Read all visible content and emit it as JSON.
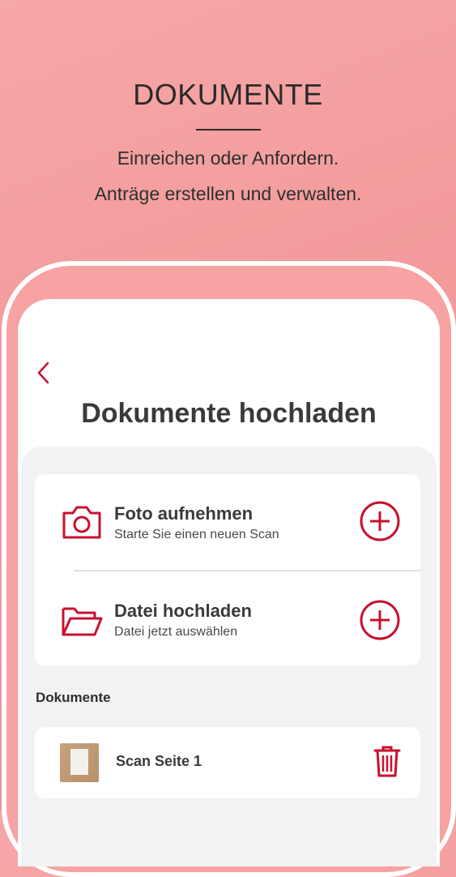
{
  "hero": {
    "title": "DOKUMENTE",
    "line1": "Einreichen oder Anfordern.",
    "line2": "Anträge erstellen und verwalten."
  },
  "screen": {
    "title": "Dokumente hochladen",
    "actions": [
      {
        "title": "Foto aufnehmen",
        "subtitle": "Starte Sie einen neuen Scan",
        "icon": "camera-icon"
      },
      {
        "title": "Datei hochladen",
        "subtitle": "Datei jetzt auswählen",
        "icon": "folder-icon"
      }
    ],
    "section_label": "Dokumente",
    "documents": [
      {
        "name": "Scan Seite 1"
      }
    ]
  },
  "colors": {
    "accent": "#c8102e",
    "background": "#f39a9b"
  }
}
